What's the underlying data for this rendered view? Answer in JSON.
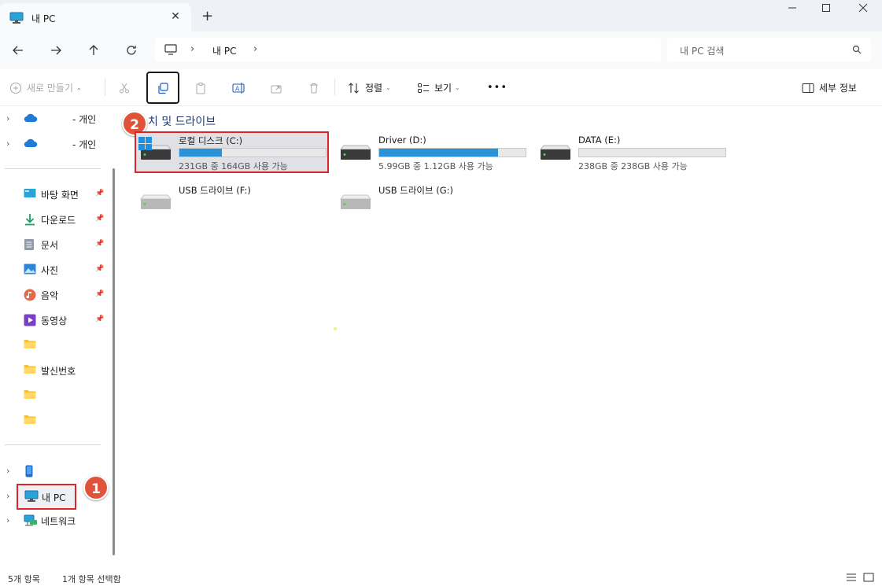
{
  "window": {
    "tab_title": "내 PC",
    "new_tab_label": "+"
  },
  "nav": {
    "breadcrumb": [
      "내 PC"
    ],
    "search_placeholder": "내 PC 검색"
  },
  "commands": {
    "new_label": "새로 만들기",
    "sort_label": "정렬",
    "view_label": "보기",
    "more_label": "•••",
    "details_label": "세부 정보"
  },
  "sidebar": {
    "cloud_items": [
      {
        "label": "- 개인"
      },
      {
        "label": "- 개인"
      }
    ],
    "quick_access": [
      {
        "label": "바탕 화면",
        "icon": "desktop-icon",
        "pinned": true
      },
      {
        "label": "다운로드",
        "icon": "download-icon",
        "pinned": true
      },
      {
        "label": "문서",
        "icon": "documents-icon",
        "pinned": true
      },
      {
        "label": "사진",
        "icon": "pictures-icon",
        "pinned": true
      },
      {
        "label": "음악",
        "icon": "music-icon",
        "pinned": true
      },
      {
        "label": "동영상",
        "icon": "videos-icon",
        "pinned": true
      },
      {
        "label": "",
        "icon": "folder-icon",
        "pinned": false
      },
      {
        "label": "발신번호",
        "icon": "folder-icon",
        "pinned": false
      },
      {
        "label": "",
        "icon": "folder-icon",
        "pinned": false
      },
      {
        "label": "",
        "icon": "folder-icon",
        "pinned": false
      }
    ],
    "devices": [
      {
        "label": "",
        "icon": "phone-icon"
      },
      {
        "label": "내 PC",
        "icon": "pc-icon"
      },
      {
        "label": "네트워크",
        "icon": "network-icon"
      }
    ]
  },
  "content": {
    "group_header": "치 및 드라이브",
    "drives": [
      {
        "name": "로컬 디스크 (C:)",
        "free_text": "231GB 중 164GB 사용 가능",
        "used_fraction": 0.29,
        "selected": true
      },
      {
        "name": "Driver (D:)",
        "free_text": "5.99GB 중 1.12GB 사용 가능",
        "used_fraction": 0.81,
        "selected": false
      },
      {
        "name": "DATA (E:)",
        "free_text": "238GB 중 238GB 사용 가능",
        "used_fraction": 0.0,
        "selected": false
      },
      {
        "name": "USB 드라이브 (F:)",
        "free_text": "",
        "used_fraction": null,
        "selected": false
      },
      {
        "name": "USB 드라이브 (G:)",
        "free_text": "",
        "used_fraction": null,
        "selected": false
      }
    ]
  },
  "annotations": {
    "badge_1": "1",
    "badge_2": "2"
  },
  "status": {
    "item_count": "5개 항목",
    "selection": "1개 항목 선택함"
  },
  "colors": {
    "accent": "#2b93d5",
    "highlight_red": "#d9262e",
    "badge": "#e0533a"
  }
}
